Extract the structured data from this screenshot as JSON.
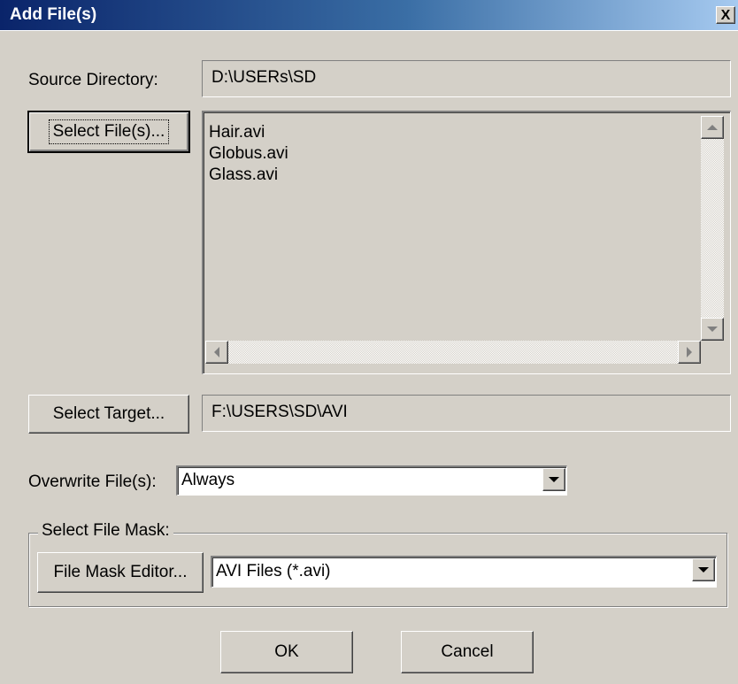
{
  "window": {
    "title": "Add File(s)",
    "close_label": "X"
  },
  "source": {
    "label": "Source Directory:",
    "value": "D:\\USERs\\SD"
  },
  "select_files_button": "Select File(s)...",
  "files": [
    "Hair.avi",
    "Globus.avi",
    "Glass.avi"
  ],
  "target": {
    "button": "Select Target...",
    "value": "F:\\USERS\\SD\\AVI"
  },
  "overwrite": {
    "label": "Overwrite File(s):",
    "value": "Always"
  },
  "file_mask": {
    "group_label": "Select File Mask:",
    "editor_button": "File Mask Editor...",
    "value": "AVI Files (*.avi)"
  },
  "buttons": {
    "ok": "OK",
    "cancel": "Cancel"
  }
}
